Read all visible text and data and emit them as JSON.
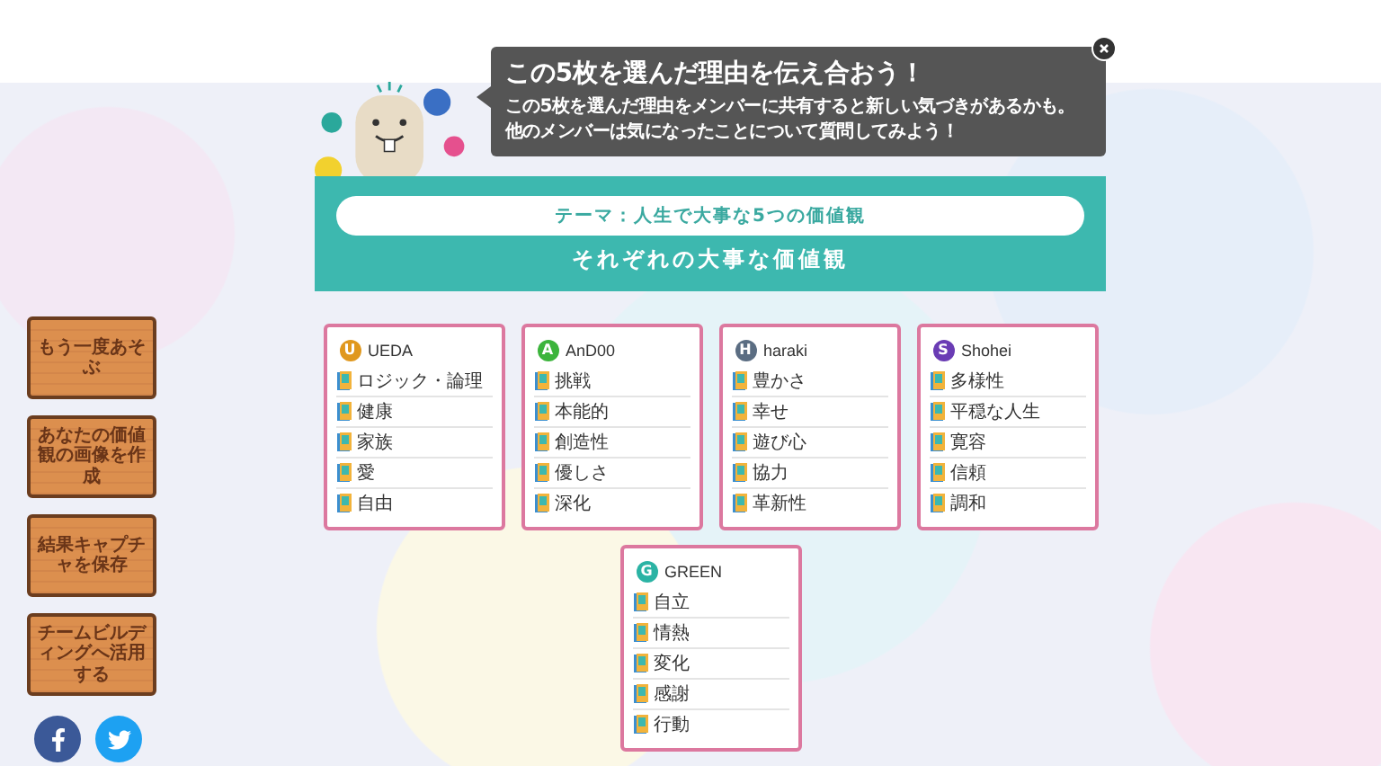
{
  "tooltip": {
    "title": "この5枚を選んだ理由を伝え合おう！",
    "lines": [
      "この5枚を選んだ理由をメンバーに共有すると新しい気づきがあるかも。",
      "他のメンバーは気になったことについて質問してみよう！"
    ]
  },
  "banner": {
    "theme": "テーマ：人生で大事な5つの価値観",
    "heading": "それぞれの大事な価値観"
  },
  "side_buttons": [
    "もう一度あそぶ",
    "あなたの価値観の画像を作成",
    "結果キャプチャを保存",
    "チームビルディングへ活用する"
  ],
  "social": [
    {
      "kind": "facebook"
    },
    {
      "kind": "twitter"
    }
  ],
  "members": [
    {
      "initial": "U",
      "name": "UEDA",
      "color": "#e0981e",
      "values": [
        "ロジック・論理",
        "健康",
        "家族",
        "愛",
        "自由"
      ]
    },
    {
      "initial": "A",
      "name": "AnD00",
      "color": "#3cb43c",
      "values": [
        "挑戦",
        "本能的",
        "創造性",
        "優しさ",
        "深化"
      ]
    },
    {
      "initial": "H",
      "name": "haraki",
      "color": "#5b6d82",
      "values": [
        "豊かさ",
        "幸せ",
        "遊び心",
        "協力",
        "革新性"
      ]
    },
    {
      "initial": "S",
      "name": "Shohei",
      "color": "#6a3cb4",
      "values": [
        "多様性",
        "平穏な人生",
        "寛容",
        "信頼",
        "調和"
      ]
    },
    {
      "initial": "G",
      "name": "GREEN",
      "color": "#2bb3a4",
      "values": [
        "自立",
        "情熱",
        "変化",
        "感謝",
        "行動"
      ]
    }
  ]
}
